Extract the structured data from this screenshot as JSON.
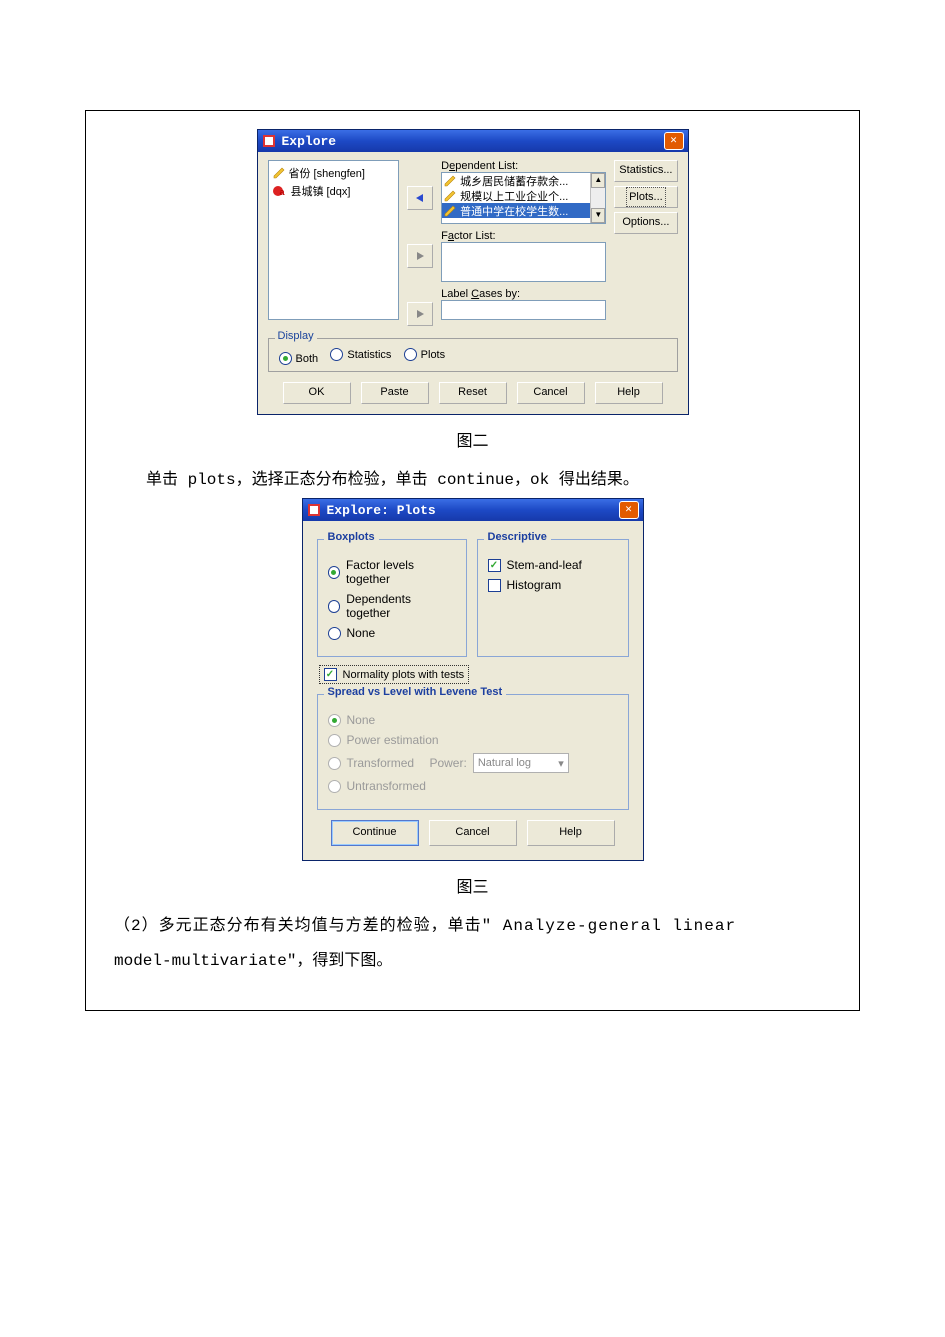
{
  "explore": {
    "title": "Explore",
    "source_items": [
      {
        "icon": "pencil",
        "label": "省份 [shengfen]"
      },
      {
        "icon": "redball",
        "label": "县城镇 [dqx]"
      }
    ],
    "dep_label_pre": "D",
    "dep_label_ul": "e",
    "dep_label_post": "pendent List:",
    "dep_items": [
      "城乡居民储蓄存款余...",
      "规模以上工业企业个...",
      "普通中学在校学生数..."
    ],
    "factor_label_pre": "F",
    "factor_label_ul": "a",
    "factor_label_post": "ctor List:",
    "labelcases_pre": "Label ",
    "labelcases_ul": "C",
    "labelcases_post": "ases by:",
    "right_buttons": {
      "stat_pre": "S",
      "stat_ul": "t",
      "stat_post": "atistics...",
      "plots_pre": "Pl",
      "plots_ul": "o",
      "plots_post": "ts...",
      "opt_pre": "",
      "opt_ul": "O",
      "opt_post": "ptions..."
    },
    "display_title": "Display",
    "display_opts": {
      "both_ul": "B",
      "both_post": "oth",
      "stats_pre": "St",
      "stats_ul": "a",
      "stats_post": "tistics",
      "plots_pre": "P",
      "plots_ul": "l",
      "plots_post": "ots"
    },
    "buttons": {
      "ok": "OK",
      "paste_ul": "P",
      "paste_post": "aste",
      "reset_ul": "R",
      "reset_post": "eset",
      "cancel": "Cancel",
      "help": "Help"
    }
  },
  "caption2": "图二",
  "para1": "单击 plots，选择正态分布检验，单击 continue，ok 得出结果。",
  "plots": {
    "title": "Explore: Plots",
    "boxplots_title": "Boxplots",
    "bp_factor_ul": "F",
    "bp_factor_post": "actor levels together",
    "bp_dep_ul": "D",
    "bp_dep_post": "ependents together",
    "bp_none_ul": "N",
    "bp_none_post": "one",
    "desc_title": "Descriptive",
    "desc_stem_ul": "S",
    "desc_stem_post": "tem-and-leaf",
    "desc_hist_ul": "H",
    "desc_hist_post": "istogram",
    "norm_ul": "N",
    "norm_post": "ormality plots with tests",
    "svl_title": "Spread vs Level with Levene Test",
    "svl_none_pre": "Non",
    "svl_none_ul": "e",
    "svl_power_ul": "P",
    "svl_power_post": "ower estimation",
    "svl_trans_ul": "T",
    "svl_trans_post": "ransformed",
    "svl_pw_lab_pre": "Po",
    "svl_pw_ul": "w",
    "svl_pw_post": "er:",
    "svl_pw_val": "Natural log",
    "svl_untrans_ul": "U",
    "svl_untrans_post": "ntransformed",
    "buttons": {
      "cont": "Continue",
      "cancel": "Cancel",
      "help": "Help"
    }
  },
  "caption3": "图三",
  "para2_a": "（2）多元正态分布有关均值与方差的检验，单击\" Analyze-general  linear",
  "para2_b": "model-multivariate\"，得到下图。"
}
